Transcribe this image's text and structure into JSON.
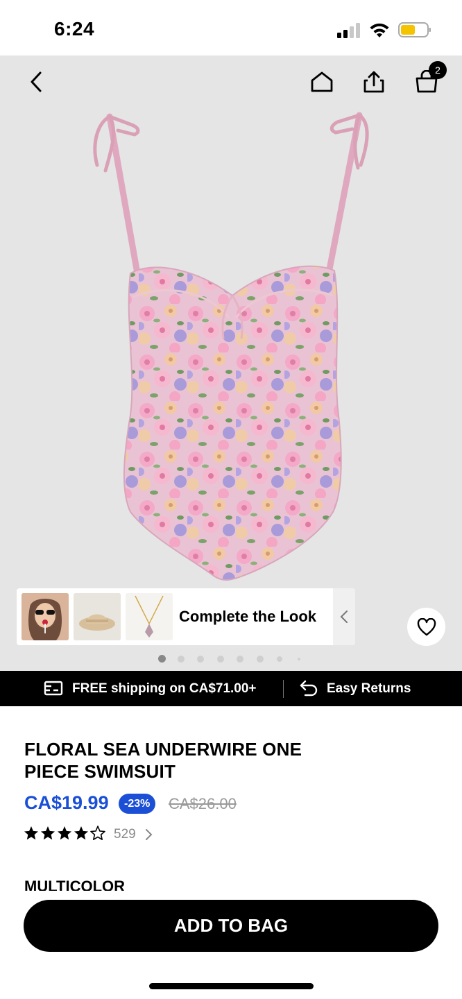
{
  "status_bar": {
    "time": "6:24",
    "icons": [
      "signal-icon",
      "wifi-icon",
      "battery-icon"
    ]
  },
  "header": {
    "icons": [
      "back-arrow-icon",
      "home-icon",
      "share-icon",
      "shopping-bag-icon"
    ],
    "bag_count": "2"
  },
  "gallery": {
    "image": "floral-swimsuit",
    "slide_count": 8,
    "active_slide": 1
  },
  "complete_look": {
    "title": "Complete the Look",
    "thumbnails": [
      "model-with-sunglasses",
      "straw-bucket-hat",
      "gold-pendant-necklace"
    ]
  },
  "shipping_banner": {
    "shipping_text": "FREE shipping on CA$71.00+",
    "returns_text": "Easy Returns"
  },
  "product": {
    "title": "FLORAL SEA UNDERWIRE ONE PIECE SWIMSUIT",
    "price": "CA$19.99",
    "discount": "-23%",
    "original_price": "CA$26.00",
    "rating": 4.5,
    "review_count": "529",
    "color_label": "MULTICOLOR"
  },
  "actions": {
    "add_to_bag": "ADD TO BAG"
  },
  "colors": {
    "price_accent": "#1a4fd6",
    "hero_bg": "#e5e5e5",
    "primary_button": "#000000"
  }
}
